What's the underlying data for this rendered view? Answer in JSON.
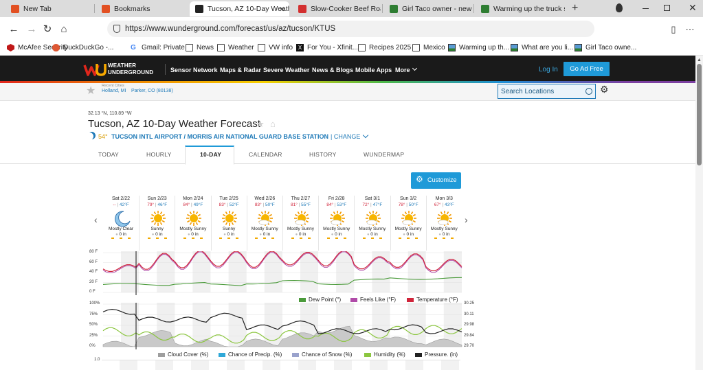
{
  "browser": {
    "tabs": [
      {
        "title": "New Tab",
        "active": false,
        "fav": "#e25022"
      },
      {
        "title": "Bookmarks",
        "active": false,
        "fav": "#e25022"
      },
      {
        "title": "Tucson, AZ 10-Day Weath",
        "active": true,
        "fav": "#222"
      },
      {
        "title": "Slow-Cooker Beef Roast",
        "active": false,
        "fav": "#d32f2f"
      },
      {
        "title": "Girl Taco owner - new to",
        "active": false,
        "fav": "#2e7d32"
      },
      {
        "title": "Warming up the truck sti",
        "active": false,
        "fav": "#2e7d32"
      }
    ],
    "url": "https://www.wunderground.com/forecast/us/az/tucson/KTUS",
    "bookmarks": [
      {
        "label": "McAfee Security",
        "icon": "mcafee-icon"
      },
      {
        "label": "DuckDuckGo -...",
        "icon": "duckduckgo-icon"
      },
      {
        "label": "Gmail: Private",
        "icon": "google-icon"
      },
      {
        "label": "News",
        "icon": "folder-icon"
      },
      {
        "label": "Weather",
        "icon": "folder-icon"
      },
      {
        "label": "VW info",
        "icon": "folder-icon"
      },
      {
        "label": "For You - Xfinit...",
        "icon": "x-icon"
      },
      {
        "label": "Recipes 2025",
        "icon": "folder-icon"
      },
      {
        "label": "Mexico",
        "icon": "folder-icon"
      },
      {
        "label": "Warming up th...",
        "icon": "image-icon"
      },
      {
        "label": "What are you li...",
        "icon": "image-icon"
      },
      {
        "label": "Girl Taco owne...",
        "icon": "image-icon"
      }
    ]
  },
  "site": {
    "logo_line1": "WEATHER",
    "logo_line2": "UNDERGROUND",
    "nav": [
      "Sensor Network",
      "Maps & Radar",
      "Severe Weather",
      "News & Blogs",
      "Mobile Apps",
      "More"
    ],
    "login": "Log In",
    "ad_free": "Go Ad Free",
    "recent_label": "Recent Cities",
    "recent_cities": [
      "Holland, MI",
      "Parker, CO (80138)"
    ],
    "search_placeholder": "Search Locations"
  },
  "page": {
    "coords": "32.13 °N, 110.89 °W",
    "title": "Tucson, AZ 10-Day Weather Forecast",
    "current_temp": "54°",
    "station": "TUCSON INTL AIRPORT / MORRIS AIR NATIONAL GUARD BASE STATION",
    "change": "| CHANGE",
    "tabs": [
      "TODAY",
      "HOURLY",
      "10-DAY",
      "CALENDAR",
      "HISTORY",
      "WUNDERMAP"
    ],
    "active_tab": "10-DAY",
    "customize": "Customize"
  },
  "days": [
    {
      "name": "Sat 2/22",
      "hi": "--",
      "lo": "42°F",
      "cond": "Mostly Clear",
      "precip": "0 in",
      "icon": "moon-icon"
    },
    {
      "name": "Sun 2/23",
      "hi": "79°",
      "lo": "46°F",
      "cond": "Sunny",
      "precip": "0 in",
      "icon": "sun-icon"
    },
    {
      "name": "Mon 2/24",
      "hi": "84°",
      "lo": "49°F",
      "cond": "Mostly Sunny",
      "precip": "0 in",
      "icon": "sun-icon"
    },
    {
      "name": "Tue 2/25",
      "hi": "83°",
      "lo": "52°F",
      "cond": "Sunny",
      "precip": "0 in",
      "icon": "sun-icon"
    },
    {
      "name": "Wed 2/26",
      "hi": "83°",
      "lo": "50°F",
      "cond": "Mostly Sunny",
      "precip": "0 in",
      "icon": "partly-sunny-icon"
    },
    {
      "name": "Thu 2/27",
      "hi": "81°",
      "lo": "55°F",
      "cond": "Mostly Sunny",
      "precip": "0 in",
      "icon": "partly-sunny-icon"
    },
    {
      "name": "Fri 2/28",
      "hi": "84°",
      "lo": "53°F",
      "cond": "Mostly Sunny",
      "precip": "0 in",
      "icon": "partly-sunny-icon"
    },
    {
      "name": "Sat 3/1",
      "hi": "72°",
      "lo": "47°F",
      "cond": "Mostly Sunny",
      "precip": "0 in",
      "icon": "partly-sunny-icon"
    },
    {
      "name": "Sun 3/2",
      "hi": "78°",
      "lo": "50°F",
      "cond": "Mostly Sunny",
      "precip": "0 in",
      "icon": "partly-sunny-icon"
    },
    {
      "name": "Mon 3/3",
      "hi": "67°",
      "lo": "43°F",
      "cond": "Mostly Sunny",
      "precip": "0 in",
      "icon": "partly-sunny-icon"
    }
  ],
  "chart_data": [
    {
      "type": "line",
      "yticks": [
        "80 F",
        "60 F",
        "40 F",
        "20 F",
        "0 F"
      ],
      "ylim": [
        0,
        80
      ],
      "series": [
        {
          "name": "Dew Point (°)",
          "color": "#4a9a3a"
        },
        {
          "name": "Feels Like (°F)",
          "color": "#b04aa8"
        },
        {
          "name": "Temperature (°F)",
          "color": "#d0243a"
        }
      ],
      "daily_high": [
        56,
        79,
        84,
        83,
        83,
        81,
        84,
        72,
        78,
        67
      ],
      "daily_low": [
        42,
        46,
        49,
        52,
        50,
        55,
        53,
        47,
        50,
        43
      ],
      "dew_point": [
        16,
        16,
        18,
        15,
        19,
        22,
        18,
        25,
        28,
        28
      ]
    },
    {
      "type": "area",
      "yticks_left": [
        "100%",
        "75%",
        "50%",
        "25%",
        "0%"
      ],
      "yticks_right": [
        "30.25",
        "30.11",
        "29.98",
        "29.84",
        "29.70"
      ],
      "series": [
        {
          "name": "Cloud Cover (%)",
          "color": "#9e9e9e"
        },
        {
          "name": "Chance of Precip. (%)",
          "color": "#2fa8d8"
        },
        {
          "name": "Chance of Snow (%)",
          "color": "#9aa2cc"
        },
        {
          "name": "Humidity (%)",
          "color": "#8bc63f"
        },
        {
          "name": "Pressure. (in)",
          "color": "#222222"
        }
      ],
      "humidity": [
        35,
        25,
        20,
        18,
        24,
        28,
        22,
        30,
        38,
        40
      ],
      "cloud_cover": [
        5,
        30,
        10,
        5,
        10,
        25,
        40,
        20,
        15,
        10
      ],
      "pressure": [
        30.15,
        30.05,
        30.05,
        30.1,
        29.95,
        30.0,
        29.9,
        29.9,
        29.95,
        29.9
      ]
    }
  ],
  "next_chart_tick": "1.0"
}
